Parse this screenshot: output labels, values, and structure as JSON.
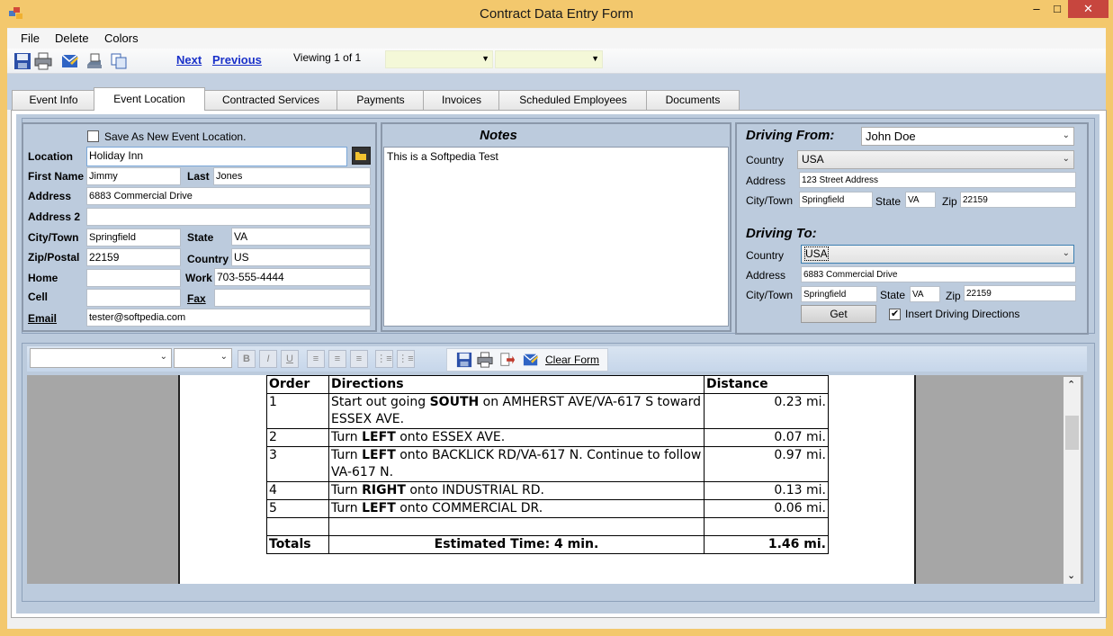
{
  "window": {
    "title": "Contract Data Entry Form",
    "minimize": "–",
    "maximize": "□",
    "close": "✕"
  },
  "menu": [
    "File",
    "Delete",
    "Colors"
  ],
  "toolbar": {
    "icons": [
      "save-icon",
      "print-icon",
      "email-icon",
      "fax-icon",
      "copy-icon"
    ],
    "next": "Next",
    "previous": "Previous",
    "viewing": "Viewing 1 of 1",
    "filter1_value": "",
    "filter2_value": ""
  },
  "tabs": [
    "Event Info",
    "Event Location",
    "Contracted Services",
    "Payments",
    "Invoices",
    "Scheduled Employees",
    "Documents"
  ],
  "active_tab": "Event Location",
  "location": {
    "save_as_new_label": "Save As New Event Location.",
    "save_as_new_checked": false,
    "location_label": "Location",
    "location_value": "Holiday Inn",
    "first_name_label": "First Name",
    "first_name_value": "Jimmy",
    "last_label": "Last",
    "last_value": "Jones",
    "address_label": "Address",
    "address_value": "6883 Commercial Drive",
    "address2_label": "Address 2",
    "address2_value": "",
    "city_label": "City/Town",
    "city_value": "Springfield",
    "state_label": "State",
    "state_value": "VA",
    "zip_label": "Zip/Postal",
    "zip_value": "22159",
    "country_label": "Country",
    "country_value": "US",
    "home_label": "Home",
    "home_value": "",
    "work_label": "Work",
    "work_value": "703-555-4444",
    "cell_label": "Cell",
    "cell_value": "",
    "fax_label": "Fax",
    "fax_value": "",
    "email_label": "Email",
    "email_value": "tester@softpedia.com"
  },
  "notes": {
    "title": "Notes",
    "text": "This is a Softpedia Test"
  },
  "driving_from": {
    "title": "Driving From:",
    "person": "John Doe",
    "country_label": "Country",
    "country_value": "USA",
    "address_label": "Address",
    "address_value": "123 Street Address",
    "city_label": "City/Town",
    "city_value": "Springfield",
    "state_label": "State",
    "state_value": "VA",
    "zip_label": "Zip",
    "zip_value": "22159"
  },
  "driving_to": {
    "title": "Driving To:",
    "country_label": "Country",
    "country_value": "USA",
    "address_label": "Address",
    "address_value": "6883 Commercial Drive",
    "city_label": "City/Town",
    "city_value": "Springfield",
    "state_label": "State",
    "state_value": "VA",
    "zip_label": "Zip",
    "zip_value": "22159",
    "get_button": "Get",
    "insert_label": "Insert Driving Directions",
    "insert_checked": true
  },
  "editor": {
    "font_value": "",
    "size_value": "",
    "format_buttons": [
      "B",
      "I",
      "U"
    ],
    "clear_form": "Clear Form"
  },
  "directions": {
    "headers": [
      "Order",
      "Directions",
      "Distance"
    ],
    "rows": [
      {
        "order": "1",
        "pre": "Start out going ",
        "bold": "SOUTH",
        "post": " on AMHERST AVE/VA-617 S toward ESSEX AVE.",
        "distance": "0.23 mi."
      },
      {
        "order": "2",
        "pre": "Turn ",
        "bold": "LEFT",
        "post": " onto ESSEX AVE.",
        "distance": "0.07 mi."
      },
      {
        "order": "3",
        "pre": "Turn ",
        "bold": "LEFT",
        "post": " onto BACKLICK RD/VA-617 N. Continue to follow VA-617 N.",
        "distance": "0.97 mi."
      },
      {
        "order": "4",
        "pre": "Turn ",
        "bold": "RIGHT",
        "post": " onto INDUSTRIAL RD.",
        "distance": "0.13 mi."
      },
      {
        "order": "5",
        "pre": "Turn ",
        "bold": "LEFT",
        "post": " onto COMMERCIAL DR.",
        "distance": "0.06 mi."
      }
    ],
    "totals_label": "Totals",
    "estimated_time": "Estimated Time: 4 min.",
    "total_distance": "1.46 mi."
  }
}
